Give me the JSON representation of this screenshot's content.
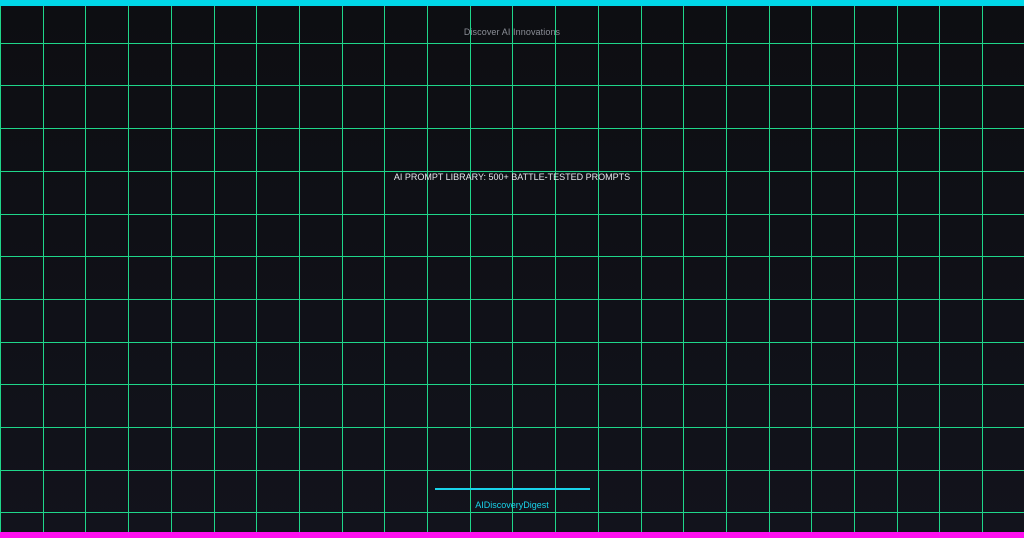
{
  "header": {
    "tagline": "Discover AI Innovations"
  },
  "main": {
    "headline": "AI PROMPT LIBRARY: 500+ BATTLE-TESTED PROMPTS"
  },
  "footer": {
    "brand": "AIDiscoveryDigest"
  },
  "colors": {
    "background": "#0e0f14",
    "grid": "#1fd68a",
    "top_bar": "#00d8e8",
    "bottom_bar": "#ff10f0",
    "accent": "#19d3ea"
  }
}
